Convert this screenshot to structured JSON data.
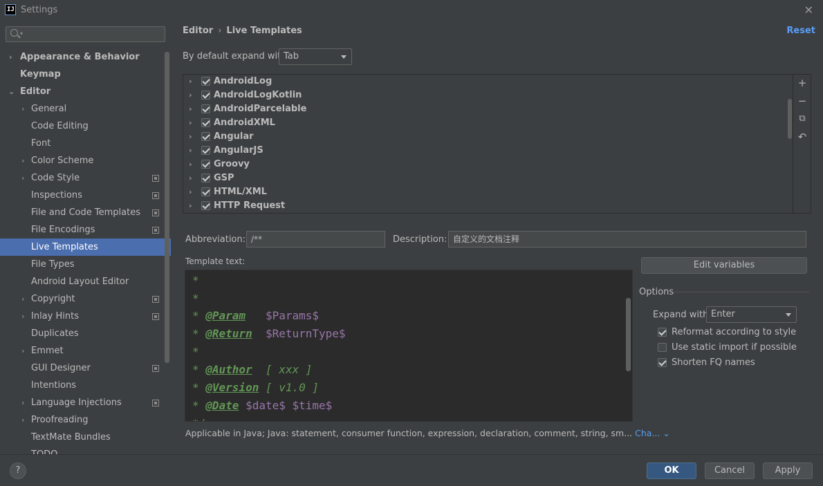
{
  "window": {
    "app_icon": "IJ",
    "title": "Settings",
    "close_glyph": "✕"
  },
  "sidebar": {
    "search_placeholder": "",
    "items": [
      {
        "label": "Appearance & Behavior",
        "arrow": "›"
      },
      {
        "label": "Keymap"
      },
      {
        "label": "Editor",
        "arrow": "⌄"
      },
      {
        "label": "General",
        "arrow": "›"
      },
      {
        "label": "Code Editing"
      },
      {
        "label": "Font"
      },
      {
        "label": "Color Scheme",
        "arrow": "›"
      },
      {
        "label": "Code Style",
        "arrow": "›"
      },
      {
        "label": "Inspections"
      },
      {
        "label": "File and Code Templates"
      },
      {
        "label": "File Encodings"
      },
      {
        "label": "Live Templates"
      },
      {
        "label": "File Types"
      },
      {
        "label": "Android Layout Editor"
      },
      {
        "label": "Copyright",
        "arrow": "›"
      },
      {
        "label": "Inlay Hints",
        "arrow": "›"
      },
      {
        "label": "Duplicates"
      },
      {
        "label": "Emmet",
        "arrow": "›"
      },
      {
        "label": "GUI Designer"
      },
      {
        "label": "Intentions"
      },
      {
        "label": "Language Injections",
        "arrow": "›"
      },
      {
        "label": "Proofreading",
        "arrow": "›"
      },
      {
        "label": "TextMate Bundles"
      },
      {
        "label": "TODO"
      }
    ]
  },
  "main": {
    "breadcrumb": {
      "parent": "Editor",
      "separator": "›",
      "current": "Live Templates"
    },
    "reset_label": "Reset",
    "expand_default_label": "By default expand with",
    "expand_default_value": "Tab",
    "template_groups": [
      {
        "label": "AndroidLog",
        "checked": true
      },
      {
        "label": "AndroidLogKotlin",
        "checked": true
      },
      {
        "label": "AndroidParcelable",
        "checked": true
      },
      {
        "label": "AndroidXML",
        "checked": true
      },
      {
        "label": "Angular",
        "checked": true
      },
      {
        "label": "AngularJS",
        "checked": true
      },
      {
        "label": "Groovy",
        "checked": true
      },
      {
        "label": "GSP",
        "checked": true
      },
      {
        "label": "HTML/XML",
        "checked": true
      },
      {
        "label": "HTTP Request",
        "checked": true
      }
    ],
    "tools": {
      "add": "+",
      "remove": "−",
      "copy": "⧉",
      "restore": "↶"
    },
    "abbreviation_label": "Abbreviation:",
    "abbreviation_value": "/**",
    "description_label": "Description:",
    "description_value": "自定义的文档注释",
    "template_text_label": "Template text:",
    "edit_variables_label": "Edit variables",
    "code_lines": {
      "l1": {
        "star": "*"
      },
      "l2": {
        "star": "*"
      },
      "l3": {
        "star": "* ",
        "tag": "@Param",
        "rest": "   ",
        "var": "$Params$"
      },
      "l4": {
        "star": "* ",
        "tag": "@Return",
        "rest": "  ",
        "var": "$ReturnType$"
      },
      "l5": {
        "star": "*"
      },
      "l6": {
        "star": "* ",
        "tag": "@Author",
        "rest": "  [ xxx ]"
      },
      "l7": {
        "star": "* ",
        "tag": "@Version",
        "rest": " [ v1.0 ]"
      },
      "l8": {
        "star": "* ",
        "tag": "@Date",
        "var1": "$date$",
        "var2": "$time$"
      },
      "l9": {
        "star": "*/"
      }
    },
    "options": {
      "title": "Options",
      "expand_with_label": "Expand with",
      "expand_with_value": "Enter",
      "checks": [
        {
          "label": "Reformat according to style",
          "checked": true
        },
        {
          "label": "Use static import if possible",
          "checked": false
        },
        {
          "label": "Shorten FQ names",
          "checked": true
        }
      ]
    },
    "applicable_text": "Applicable in Java; Java: statement, consumer function, expression, declaration, comment, string, sm...",
    "change_link": "Cha...",
    "change_chevron": "⌄"
  },
  "footer": {
    "help": "?",
    "ok": "OK",
    "cancel": "Cancel",
    "apply": "Apply"
  }
}
